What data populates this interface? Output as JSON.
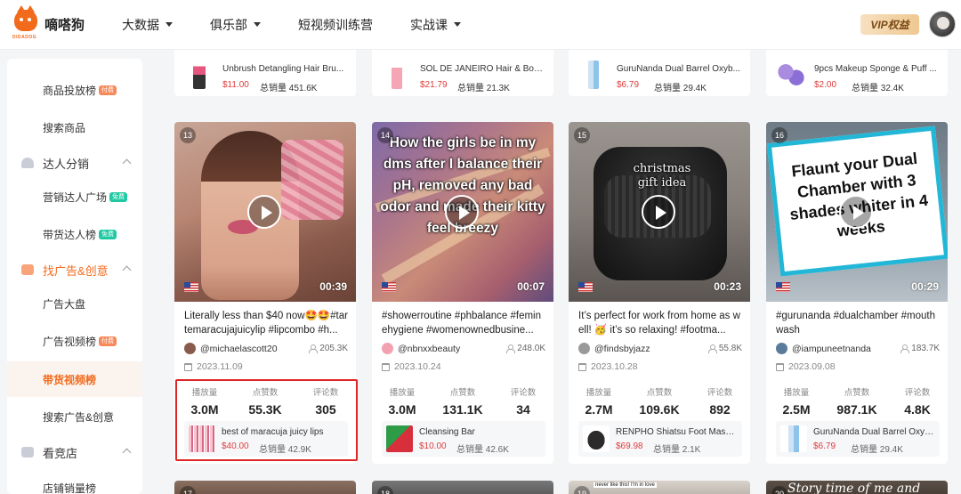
{
  "header": {
    "logo_text": "嘀嗒狗",
    "logo_sub": "DIDADOG",
    "nav": [
      {
        "label": "大数据",
        "has_dropdown": true
      },
      {
        "label": "俱乐部",
        "has_dropdown": true
      },
      {
        "label": "短视频训练营",
        "has_dropdown": false
      },
      {
        "label": "实战课",
        "has_dropdown": true
      }
    ],
    "vip_label": "VIP权益"
  },
  "sidebar": {
    "items": [
      {
        "label": "商品投放榜",
        "badge": "付费"
      },
      {
        "label": "搜索商品"
      },
      {
        "label": "达人分销",
        "group": true
      },
      {
        "label": "营销达人广场",
        "badge": "免费"
      },
      {
        "label": "带货达人榜",
        "badge": "免费"
      },
      {
        "label": "找广告&创意",
        "group": true
      },
      {
        "label": "广告大盘"
      },
      {
        "label": "广告视频榜",
        "badge": "付费"
      },
      {
        "label": "带货视频榜",
        "active": true
      },
      {
        "label": "搜索广告&创意"
      },
      {
        "label": "看竞店",
        "group": true
      },
      {
        "label": "店铺销量榜"
      }
    ]
  },
  "labels": {
    "plays": "播放量",
    "likes": "点赞数",
    "comments": "评论数",
    "total_sales": "总销量"
  },
  "top_products": [
    {
      "name": "Unbrush Detangling Hair Bru...",
      "price": "$11.00",
      "sales": "451.6K"
    },
    {
      "name": "SOL DE JANEIRO Hair & Body...",
      "price": "$21.79",
      "sales": "21.3K"
    },
    {
      "name": "GuruNanda Dual Barrel Oxyb...",
      "price": "$6.79",
      "sales": "29.4K"
    },
    {
      "name": "9pcs Makeup Sponge & Puff ...",
      "price": "$2.00",
      "sales": "32.4K"
    }
  ],
  "cards": [
    {
      "index": "13",
      "duration": "00:39",
      "overlay": "",
      "title": "Literally less than $40 now🤩🤩#tartemaracujajuicylip #lipcombo #h...",
      "author": "@michaelascott20",
      "fans": "205.3K",
      "date": "2023.11.09",
      "plays": "3.0M",
      "likes": "55.3K",
      "comments": "305",
      "product": {
        "name": "best of maracuja juicy lips",
        "price": "$40.00",
        "sales": "42.9K"
      }
    },
    {
      "index": "14",
      "duration": "00:07",
      "overlay": "How the girls be in my dms after I balance their pH, removed any bad odor and made their kitty feel breezy",
      "title": "#showerroutine #phbalance #feminehygiene #womenownedbusine...",
      "author": "@nbnxxbeauty",
      "fans": "248.0K",
      "date": "2023.10.24",
      "plays": "3.0M",
      "likes": "131.1K",
      "comments": "34",
      "product": {
        "name": "Cleansing Bar",
        "price": "$10.00",
        "sales": "42.6K"
      }
    },
    {
      "index": "15",
      "duration": "00:23",
      "overlay": "christmas gift idea",
      "title": "It’s perfect for work from home as well! 🥳 it’s so relaxing! #footma...",
      "author": "@findsbyjazz",
      "fans": "55.8K",
      "date": "2023.10.28",
      "plays": "2.7M",
      "likes": "109.6K",
      "comments": "892",
      "product": {
        "name": "RENPHO Shiatsu Foot Massa...",
        "price": "$69.98",
        "sales": "2.1K"
      }
    },
    {
      "index": "16",
      "duration": "00:29",
      "overlay": "Flaunt your Dual Chamber with 3 shades whiter in 4 weeks",
      "title": "#gurunanda #dualchamber #mouthwash",
      "author": "@iampuneetnanda",
      "fans": "183.7K",
      "date": "2023.09.08",
      "plays": "2.5M",
      "likes": "987.1K",
      "comments": "4.8K",
      "product": {
        "name": "GuruNanda Dual Barrel Oxyb...",
        "price": "$6.79",
        "sales": "29.4K"
      }
    }
  ],
  "bottom_cards": [
    {
      "index": "17",
      "overlay": ""
    },
    {
      "index": "18",
      "overlay": ""
    },
    {
      "index": "19",
      "overlay": "never like this! I'm in love"
    },
    {
      "index": "20",
      "overlay": "Story time of me and"
    }
  ],
  "colors": {
    "brand": "#f26a1b",
    "price": "#e03c3c",
    "highlight": "#e02525"
  }
}
